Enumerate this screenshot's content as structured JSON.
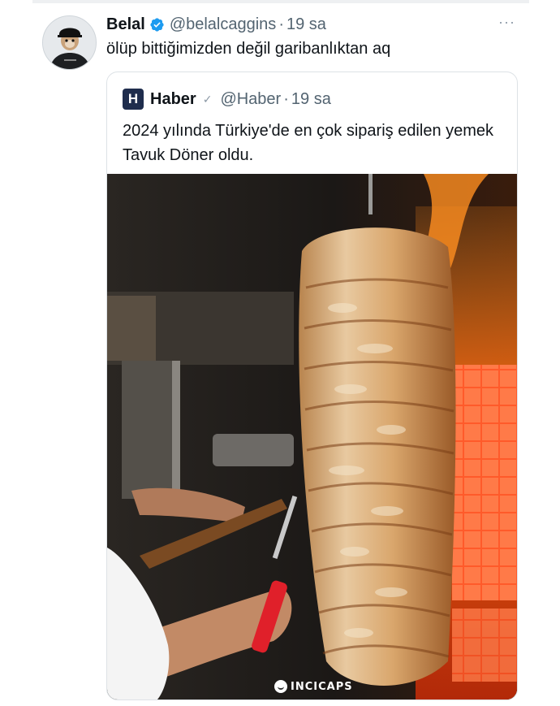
{
  "tweet": {
    "author_name": "Belal",
    "handle": "@belalcaggins",
    "separator": "·",
    "time": "19 sa",
    "text": "ölüp bittiğimizden değil garibanlıktan aq",
    "more_label": "···"
  },
  "quote": {
    "logo_letter": "H",
    "author_name": "Haber",
    "handle": "@Haber",
    "separator": "·",
    "time": "19 sa",
    "text": "2024 yılında Türkiye'de en çok sipariş edilen yemek Tavuk Döner oldu.",
    "image_watermark": "INCICAPS"
  },
  "colors": {
    "verified_blue": "#1d9bf0",
    "secondary_text": "#536471",
    "logo_bg": "#1f2d4d"
  },
  "icons": {
    "verified": "verified-badge-icon",
    "more": "more-dots-icon",
    "watermark": "incicaps-logo-icon"
  }
}
